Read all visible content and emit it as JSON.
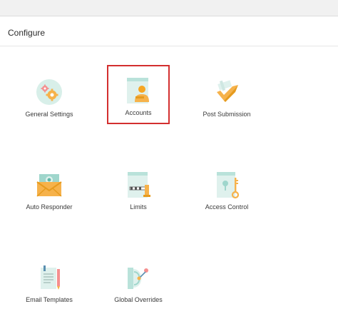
{
  "header": {
    "title": "Configure"
  },
  "accent": {
    "selection": "#d32f2f"
  },
  "tiles": [
    {
      "label": "General Settings",
      "icon": "gears-icon"
    },
    {
      "label": "Accounts",
      "icon": "account-user-icon",
      "selected": true
    },
    {
      "label": "Post Submission",
      "icon": "checkmark-flag-icon"
    },
    {
      "label": "Auto Responder",
      "icon": "envelope-photo-icon"
    },
    {
      "label": "Limits",
      "icon": "barrier-gate-icon"
    },
    {
      "label": "Access Control",
      "icon": "key-icon"
    },
    {
      "label": "Email Templates",
      "icon": "document-pen-icon"
    },
    {
      "label": "Global Overrides",
      "icon": "override-switch-icon"
    }
  ]
}
